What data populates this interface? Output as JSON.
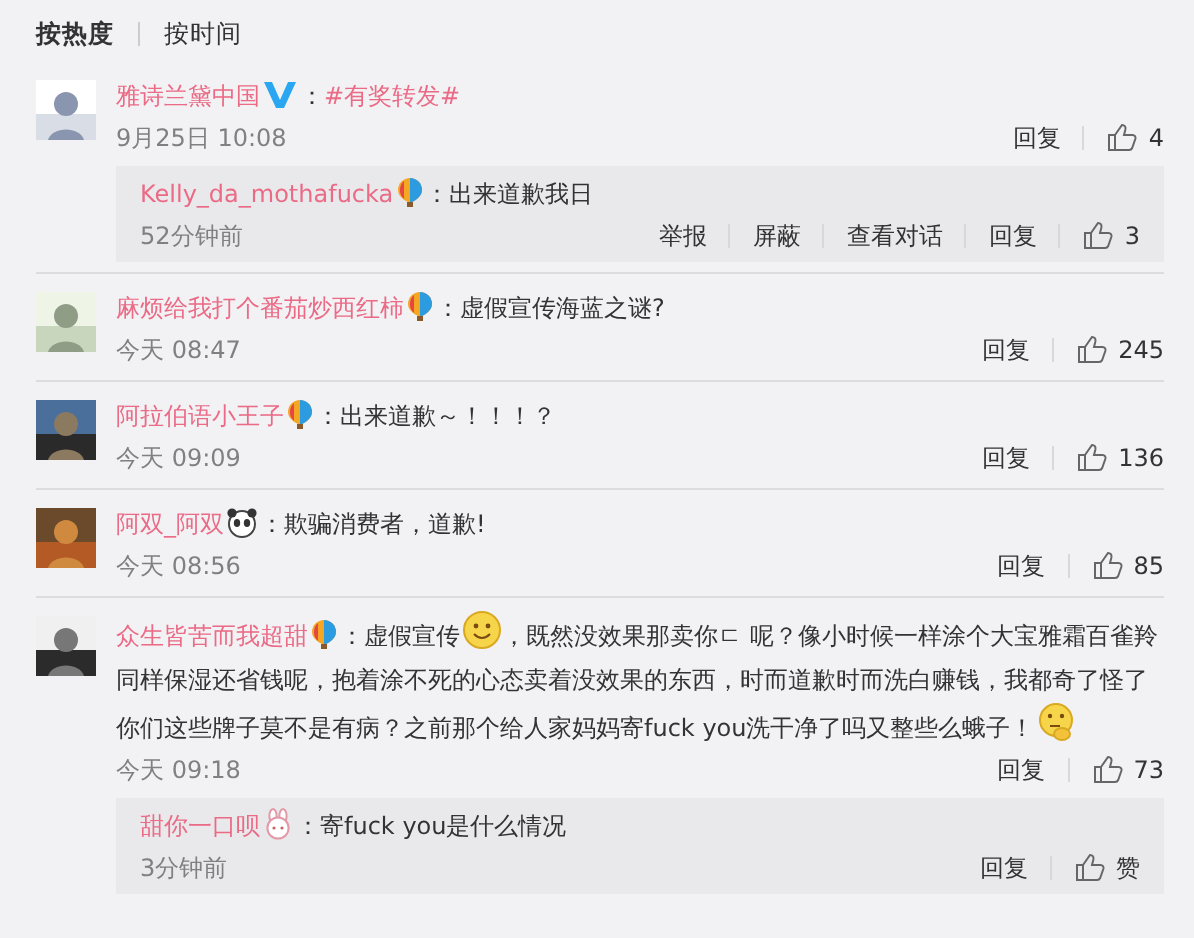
{
  "sort_tabs": [
    {
      "label": "按热度",
      "selected": true
    },
    {
      "label": "按时间",
      "selected": false
    }
  ],
  "comments": [
    {
      "avatar": {
        "kind": "picture"
      },
      "name": "雅诗兰黛中国",
      "badge": {
        "kind": "verified"
      },
      "text": [
        {
          "kind": "text",
          "text": "："
        },
        {
          "kind": "topic",
          "text": "#有奖转发#"
        }
      ],
      "time": "9月25日 10:08",
      "actions": [
        "回复"
      ],
      "likes": "4",
      "replies": [
        {
          "name": "Kelly_da_mothafucka",
          "badge": {
            "kind": "balloon"
          },
          "text": [
            {
              "kind": "text",
              "text": "：出来道歉我日"
            }
          ],
          "time": "52分钟前",
          "actions": [
            "举报",
            "屏蔽",
            "查看对话",
            "回复"
          ],
          "likes": "3"
        }
      ]
    },
    {
      "avatar": {
        "kind": "picture"
      },
      "name": "麻烦给我打个番茄炒西红柿",
      "badge": {
        "kind": "balloon"
      },
      "text": [
        {
          "kind": "text",
          "text": "：虚假宣传海蓝之谜?"
        }
      ],
      "time": "今天 08:47",
      "actions": [
        "回复"
      ],
      "likes": "245"
    },
    {
      "avatar": {
        "kind": "picture"
      },
      "name": "阿拉伯语小王子",
      "badge": {
        "kind": "balloon"
      },
      "text": [
        {
          "kind": "text",
          "text": "：出来道歉～！！！？"
        }
      ],
      "time": "今天 09:09",
      "actions": [
        "回复"
      ],
      "likes": "136"
    },
    {
      "avatar": {
        "kind": "picture"
      },
      "name": "阿双_阿双",
      "badge": {
        "kind": "panda"
      },
      "text": [
        {
          "kind": "text",
          "text": "：欺骗消费者，道歉!"
        }
      ],
      "time": "今天 08:56",
      "actions": [
        "回复"
      ],
      "likes": "85"
    },
    {
      "avatar": {
        "kind": "picture"
      },
      "name": "众生皆苦而我超甜",
      "badge": {
        "kind": "balloon"
      },
      "text": [
        {
          "kind": "text",
          "text": "：虚假宣传"
        },
        {
          "kind": "smile"
        },
        {
          "kind": "text",
          "text": "，既然没效果那卖你ㄷ 呢？像小时候一样涂个大宝雅霜百雀羚"
        },
        {
          "kind": "line",
          "text": "同样保湿还省钱呢，抱着涂不死的心态卖着没效果的东西，时而道歉时而洗白赚钱，我都奇了怪了"
        },
        {
          "kind": "text",
          "text": "你们这些牌子莫不是有病？之前那个给人家妈妈寄fuck you洗干净了吗又整些么蛾子！"
        },
        {
          "kind": "think"
        }
      ],
      "time": "今天 09:18",
      "actions": [
        "回复"
      ],
      "likes": "73",
      "replies": [
        {
          "name": "甜你一口呗",
          "badge": {
            "kind": "rabbit"
          },
          "text": [
            {
              "kind": "text",
              "text": "：寄fuck you是什么情况"
            }
          ],
          "time": "3分钟前",
          "actions": [
            "回复"
          ],
          "likes": "赞"
        }
      ]
    }
  ]
}
